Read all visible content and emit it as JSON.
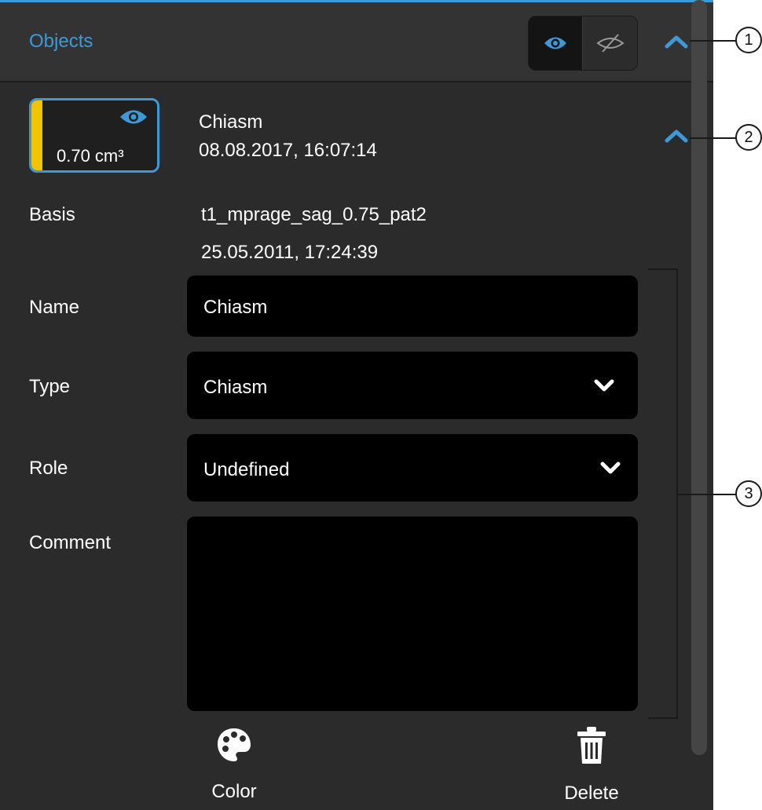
{
  "header": {
    "title": "Objects"
  },
  "visibility_toggle": {
    "show_icon": "eye-icon",
    "hide_icon": "eye-slash-icon",
    "active": "show"
  },
  "object": {
    "volume": "0.70 cm³",
    "color": "#f3c300",
    "name": "Chiasm",
    "datetime": "08.08.2017, 16:07:14"
  },
  "details": {
    "basis_label": "Basis",
    "basis_series": "t1_mprage_sag_0.75_pat2",
    "basis_datetime": "25.05.2011, 17:24:39",
    "name_label": "Name",
    "name_value": "Chiasm",
    "type_label": "Type",
    "type_value": "Chiasm",
    "role_label": "Role",
    "role_value": "Undefined",
    "comment_label": "Comment",
    "comment_value": ""
  },
  "actions": {
    "color_label": "Color",
    "delete_label": "Delete"
  },
  "callouts": [
    "1",
    "2",
    "3"
  ],
  "colors": {
    "accent": "#3e9ad6",
    "panel": "#2b2b2b",
    "header": "#333333",
    "field": "#000000"
  }
}
